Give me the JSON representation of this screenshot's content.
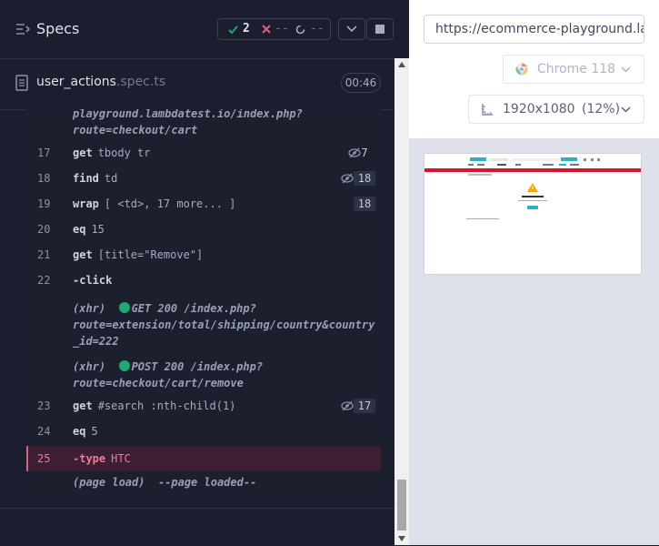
{
  "header": {
    "title": "Specs",
    "passed": "2",
    "failed": "--",
    "pending": "--"
  },
  "spec": {
    "file_name": "user_actions",
    "file_ext": ".spec.ts",
    "duration": "00:46"
  },
  "commands": {
    "top_cut_line1": "playground.lambdatest.io/index.php?",
    "top_cut_line2": "route=checkout/cart",
    "rows": [
      {
        "num": "17",
        "name": "get",
        "msg": "tbody tr",
        "count": "7"
      },
      {
        "num": "18",
        "name": "find",
        "msg": "td",
        "count": "18"
      },
      {
        "num": "19",
        "name": "wrap",
        "msg": "[ <td>, 17 more... ]",
        "count": "18"
      },
      {
        "num": "20",
        "name": "eq",
        "msg": "15"
      },
      {
        "num": "21",
        "name": "get",
        "msg": "[title=\"Remove\"]"
      },
      {
        "num": "22",
        "name": "-click",
        "msg": ""
      },
      {
        "num": "23",
        "name": "get",
        "msg": "#search :nth-child(1)",
        "count": "17"
      },
      {
        "num": "24",
        "name": "eq",
        "msg": "5"
      },
      {
        "num": "25",
        "name": "-type",
        "msg": "HTC"
      }
    ],
    "xhr1": {
      "prefix": "(xhr)",
      "line1": "GET 200 /index.php?",
      "line2": "route=extension/total/shipping/country&country",
      "line3": "_id=222"
    },
    "xhr2": {
      "prefix": "(xhr)",
      "line1": "POST 200 /index.php?",
      "line2": "route=checkout/cart/remove"
    },
    "page_load": {
      "prefix": "(page load)",
      "msg": "--page loaded--"
    }
  },
  "aut": {
    "url": "https://ecommerce-playground.lambdatest.io/index.php?route=checkout/cart",
    "browser": "Chrome 118",
    "viewport": "1920x1080",
    "scale": "(12%)"
  },
  "colors": {
    "pass": "#1fa971",
    "fail": "#e05c80",
    "accent": "#f07a9a"
  }
}
